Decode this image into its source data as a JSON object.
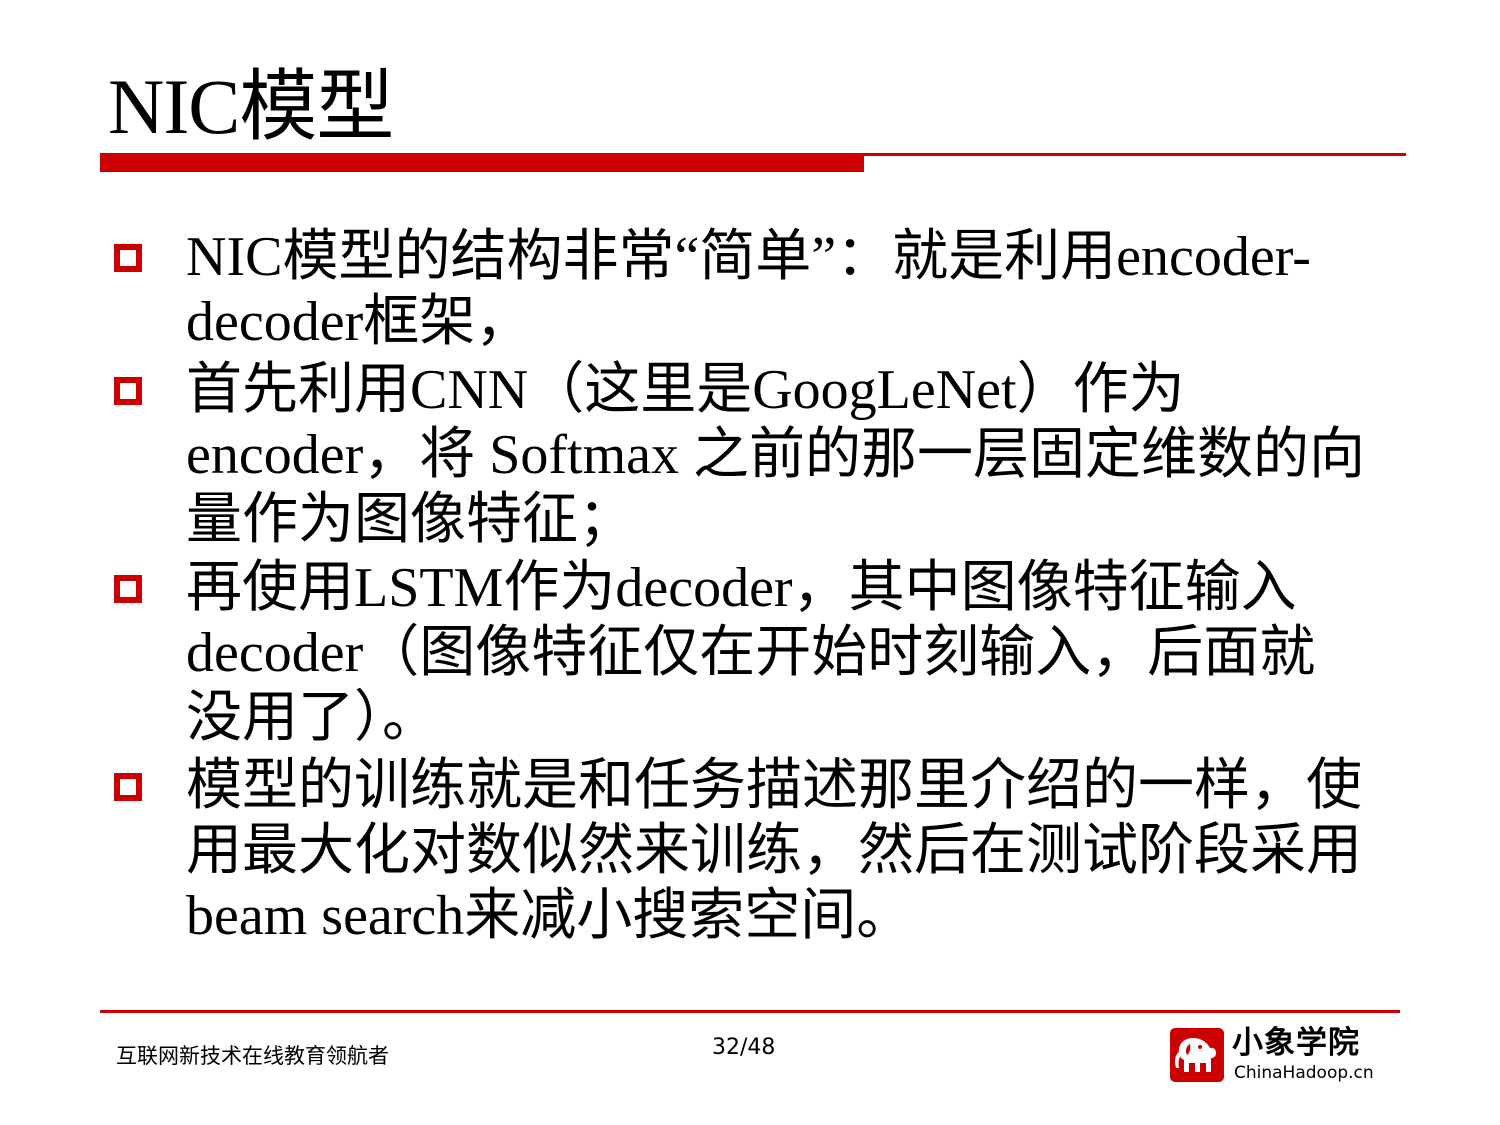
{
  "slide": {
    "title": "NIC模型",
    "bullets": [
      "NIC模型的结构非常“简单”：就是利用encoder-decoder框架，",
      "首先利用CNN（这里是GoogLeNet）作为encoder，将 Softmax 之前的那一层固定维数的向量作为图像特征；",
      "再使用LSTM作为decoder，其中图像特征输入decoder（图像特征仅在开始时刻输入，后面就没用了）。",
      "模型的训练就是和任务描述那里介绍的一样，使用最大化对数似然来训练，然后在测试阶段采用beam search来减小搜索空间。"
    ]
  },
  "footer": {
    "tagline": "互联网新技术在线教育领航者",
    "page_number": "32/48"
  },
  "logo": {
    "name": "小象学院",
    "url": "ChinaHadoop.cn",
    "icon": "elephant-icon"
  },
  "colors": {
    "accent": "#cc0000",
    "text": "#000000",
    "background": "#ffffff"
  }
}
